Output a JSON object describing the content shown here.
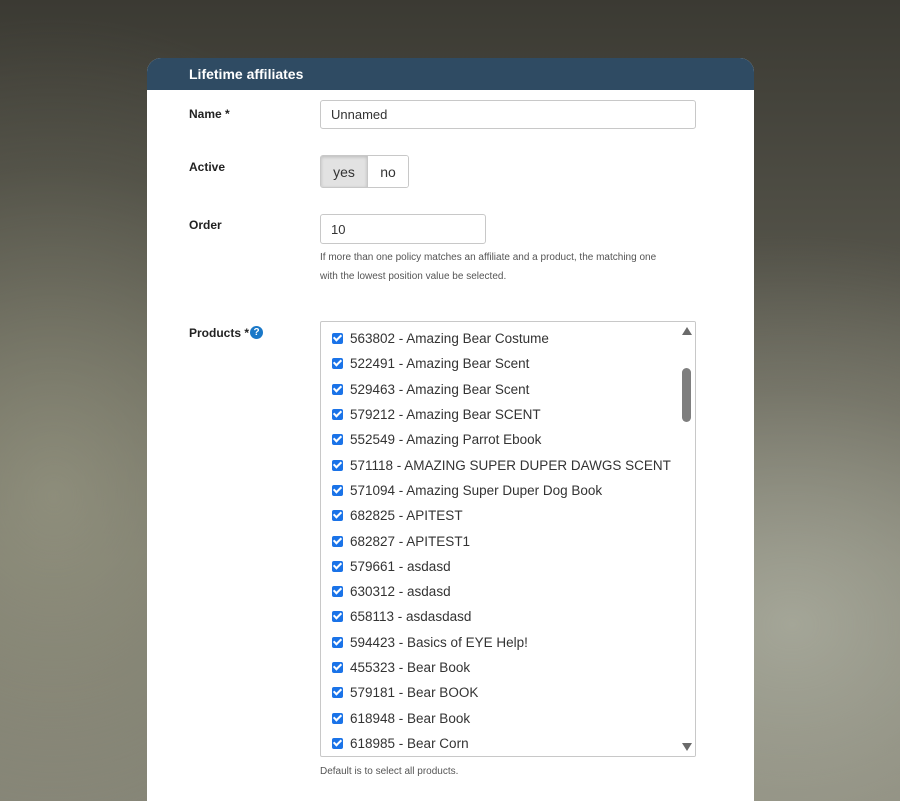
{
  "panel": {
    "title": "Lifetime affiliates"
  },
  "form": {
    "name": {
      "label": "Name *",
      "value": "Unnamed"
    },
    "active": {
      "label": "Active",
      "options": [
        "yes",
        "no"
      ],
      "selected": "yes"
    },
    "order": {
      "label": "Order",
      "value": "10",
      "help_line1": "If more than one policy matches an affiliate and a product, the matching one",
      "help_line2": "with the lowest position value be selected."
    },
    "products": {
      "label": "Products *",
      "help_icon": "question-circle-icon",
      "help": "Default is to select all products.",
      "items": [
        {
          "label": "563802 - Amazing Bear Costume",
          "checked": true
        },
        {
          "label": "522491 - Amazing Bear Scent",
          "checked": true
        },
        {
          "label": "529463 - Amazing Bear Scent",
          "checked": true
        },
        {
          "label": "579212 - Amazing Bear SCENT",
          "checked": true
        },
        {
          "label": "552549 - Amazing Parrot Ebook",
          "checked": true
        },
        {
          "label": "571118 - AMAZING SUPER DUPER DAWGS SCENT",
          "checked": true
        },
        {
          "label": "571094 - Amazing Super Duper Dog Book",
          "checked": true
        },
        {
          "label": "682825 - APITEST",
          "checked": true
        },
        {
          "label": "682827 - APITEST1",
          "checked": true
        },
        {
          "label": "579661 - asdasd",
          "checked": true
        },
        {
          "label": "630312 - asdasd",
          "checked": true
        },
        {
          "label": "658113 - asdasdasd",
          "checked": true
        },
        {
          "label": "594423 - Basics of EYE Help!",
          "checked": true
        },
        {
          "label": "455323 - Bear Book",
          "checked": true
        },
        {
          "label": "579181 - Bear BOOK",
          "checked": true
        },
        {
          "label": "618948 - Bear Book",
          "checked": true
        },
        {
          "label": "618985 - Bear Corn",
          "checked": true
        }
      ]
    }
  },
  "colors": {
    "header_bg": "#2f4b63",
    "checkbox": "#1a73e8",
    "help_icon": "#1a78c8"
  }
}
